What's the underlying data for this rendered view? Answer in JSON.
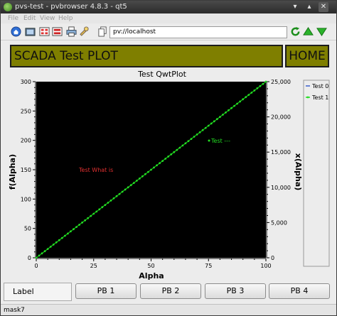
{
  "window": {
    "title": "pvs-test - pvbrowser 4.8.3 - qt5",
    "min_glyph": "▾",
    "max_glyph": "▴",
    "close_glyph": "✕"
  },
  "menu": {
    "items": [
      "File",
      "Edit",
      "View",
      "Help"
    ]
  },
  "toolbar": {
    "url": "pv://localhost"
  },
  "header": {
    "title": "SCADA Test  PLOT",
    "home_label": "HOME"
  },
  "plot": {
    "annotation_red": "Test What is",
    "annotation_green": "Test ---"
  },
  "chart_data": {
    "type": "line",
    "title": "Test QwtPlot",
    "xlabel": "Alpha",
    "ylabel": "f(Alpha)",
    "y2label": "x(Alpha)",
    "xlim": [
      0,
      100
    ],
    "ylim": [
      0,
      300
    ],
    "y2lim": [
      0,
      25000
    ],
    "xticks": [
      "0",
      "25",
      "50",
      "75",
      "100"
    ],
    "yticks": [
      "0",
      "50",
      "100",
      "150",
      "200",
      "250",
      "300"
    ],
    "y2ticks": [
      "0",
      "5,000",
      "10,000",
      "15,000",
      "20,000",
      "25,000"
    ],
    "grid": false,
    "legend": "right",
    "background": "#000000",
    "series": [
      {
        "name": "Test 0",
        "color": "#3a5fcd",
        "x": [
          0,
          100
        ],
        "y": [
          0,
          300
        ]
      },
      {
        "name": "Test 1",
        "color": "#22dd22",
        "x": [
          0,
          10,
          20,
          30,
          40,
          50,
          60,
          70,
          80,
          90,
          100
        ],
        "y": [
          0,
          30,
          60,
          90,
          120,
          150,
          180,
          210,
          240,
          270,
          300
        ]
      }
    ]
  },
  "buttons": {
    "label": "Label",
    "pb": [
      "PB 1",
      "PB 2",
      "PB 3",
      "PB 4"
    ]
  },
  "status": {
    "text": "mask7"
  }
}
